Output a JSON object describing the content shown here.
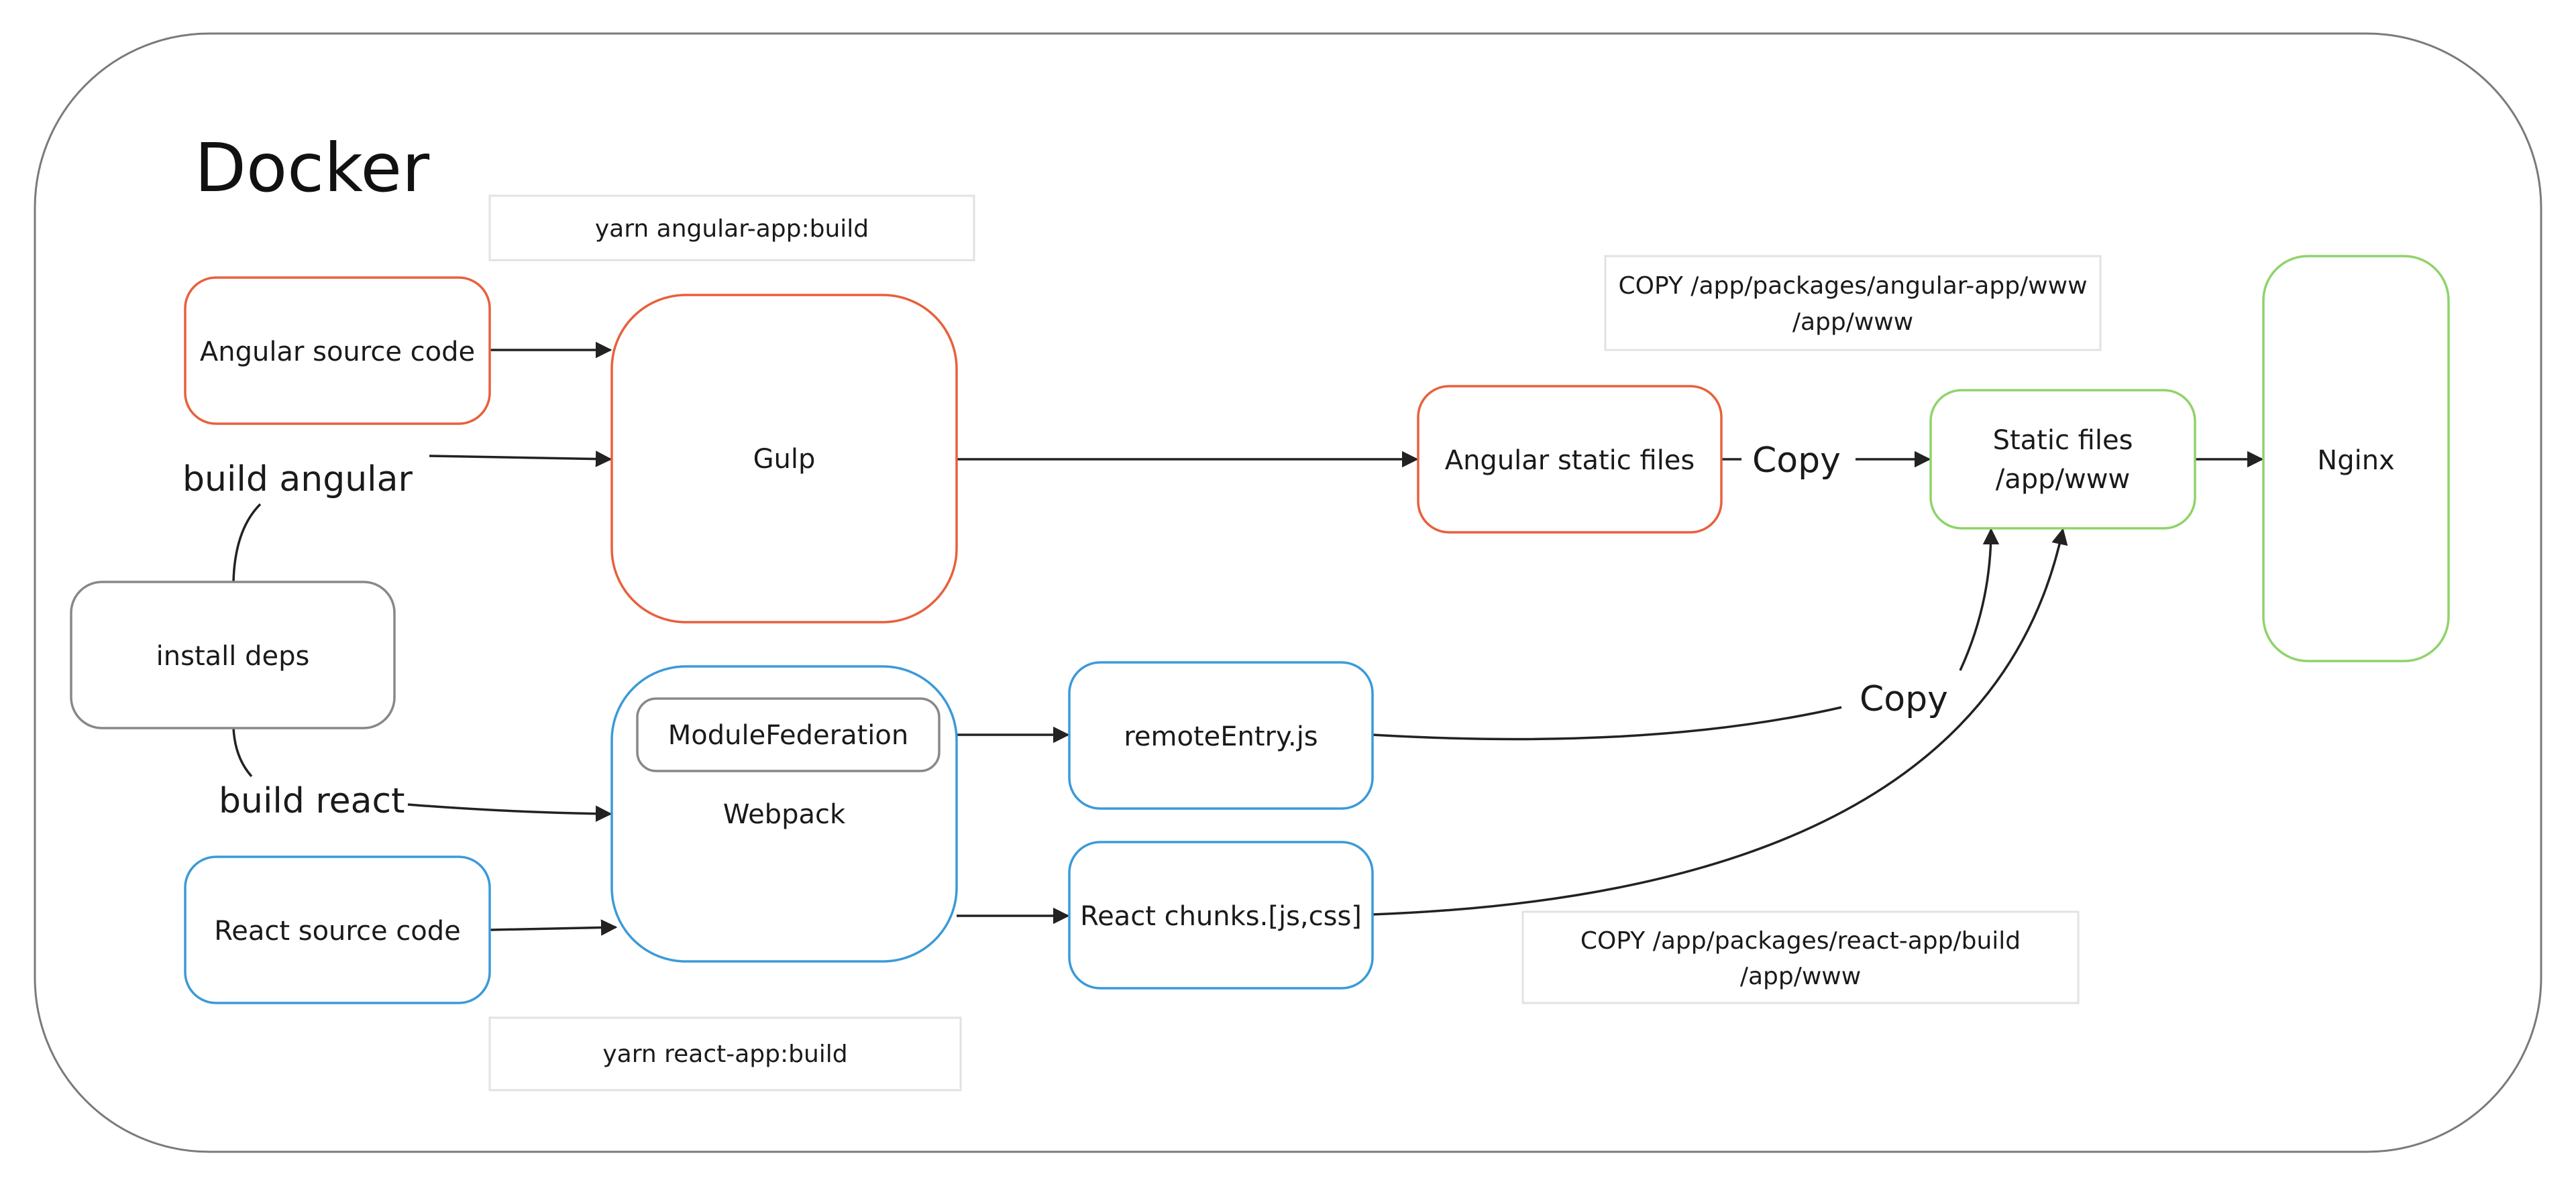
{
  "diagram": {
    "title": "Docker",
    "colors": {
      "angular": "#e8603c",
      "react": "#3a9ad9",
      "output": "#8fd36a",
      "neutral": "#888888",
      "note_border": "#e2e2e2",
      "edge": "#222222"
    },
    "nodes": {
      "angular_source": "Angular source code",
      "gulp": "Gulp",
      "install_deps": "install deps",
      "webpack": "Webpack",
      "module_federation": "ModuleFederation",
      "react_source": "React source code",
      "angular_static": "Angular static files",
      "remote_entry": "remoteEntry.js",
      "react_chunks": "React chunks.[js,css]",
      "static_files_line1": "Static files",
      "static_files_line2": "/app/www",
      "nginx": "Nginx"
    },
    "edge_labels": {
      "build_angular": "build angular",
      "build_react": "build react",
      "copy_angular": "Copy",
      "copy_react": "Copy"
    },
    "notes": {
      "yarn_angular": "yarn angular-app:build",
      "yarn_react": "yarn react-app:build",
      "copy_angular_line1": "COPY /app/packages/angular-app/www",
      "copy_angular_line2": "/app/www",
      "copy_react_line1": "COPY /app/packages/react-app/build",
      "copy_react_line2": "/app/www"
    }
  }
}
